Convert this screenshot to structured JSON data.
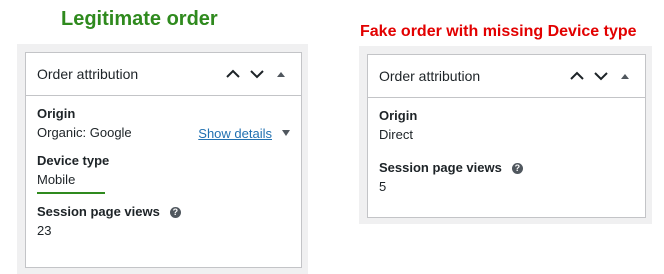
{
  "captions": {
    "legit": "Legitimate order",
    "fake": "Fake order with missing Device type"
  },
  "legit_panel": {
    "title": "Order attribution",
    "origin_label": "Origin",
    "origin_value": "Organic: Google",
    "show_details": "Show details",
    "device_label": "Device type",
    "device_value": "Mobile",
    "views_label": "Session page views",
    "views_value": "23"
  },
  "fake_panel": {
    "title": "Order attribution",
    "origin_label": "Origin",
    "origin_value": "Direct",
    "views_label": "Session page views",
    "views_value": "5"
  },
  "help_glyph": "?",
  "colors": {
    "legit_caption": "#2f8a1e",
    "fake_caption": "#e20000",
    "link": "#2271b1",
    "frame": "#f0f0f1"
  },
  "icons": [
    "chevron-up-icon",
    "chevron-down-icon",
    "caret-up-icon",
    "help-icon",
    "caret-down-icon"
  ]
}
